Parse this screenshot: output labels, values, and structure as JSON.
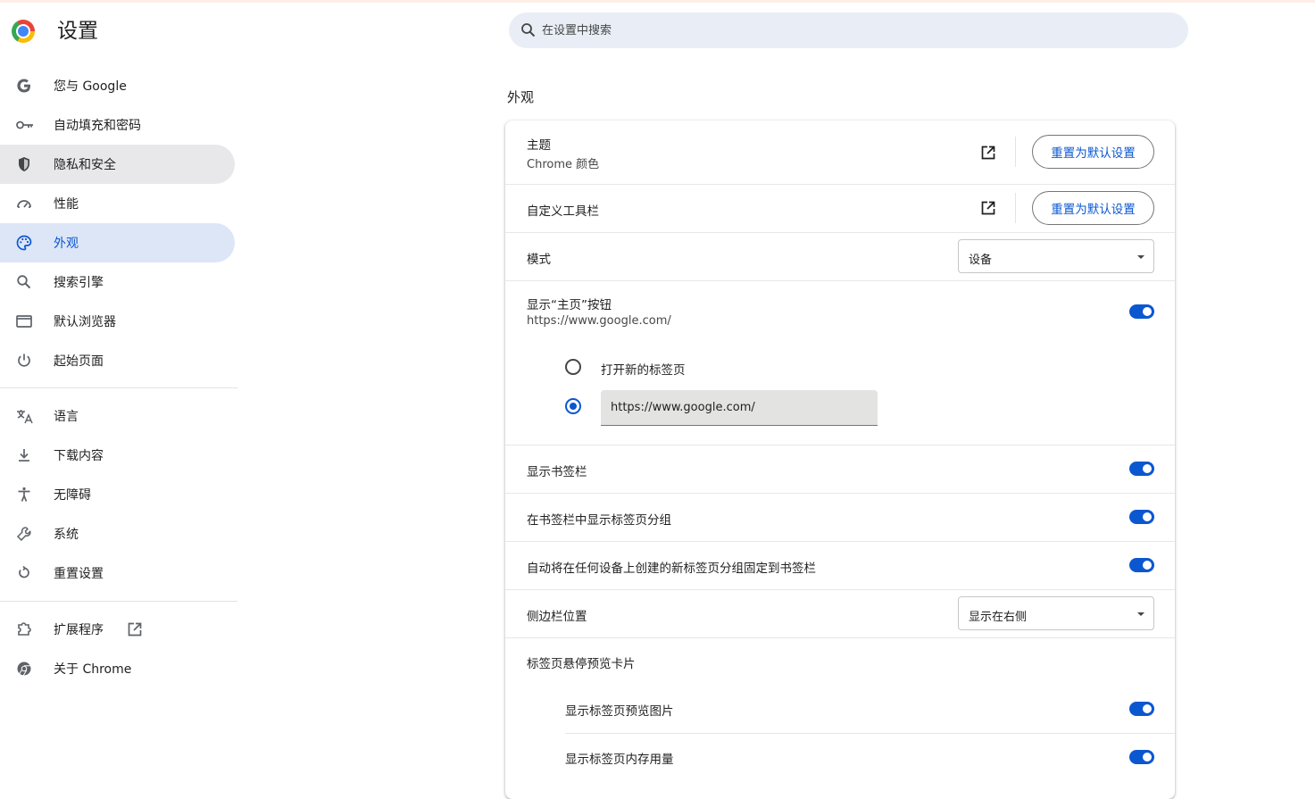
{
  "app": {
    "title": "设置"
  },
  "search": {
    "placeholder": "在设置中搜索"
  },
  "sidebar": {
    "items": [
      {
        "label": "您与 Google",
        "icon": "google-g-icon"
      },
      {
        "label": "自动填充和密码",
        "icon": "key-icon"
      },
      {
        "label": "隐私和安全",
        "icon": "shield-icon"
      },
      {
        "label": "性能",
        "icon": "speedometer-icon"
      },
      {
        "label": "外观",
        "icon": "palette-icon"
      },
      {
        "label": "搜索引擎",
        "icon": "search-icon"
      },
      {
        "label": "默认浏览器",
        "icon": "browser-window-icon"
      },
      {
        "label": "起始页面",
        "icon": "power-icon"
      },
      {
        "label": "语言",
        "icon": "translate-icon"
      },
      {
        "label": "下载内容",
        "icon": "download-icon"
      },
      {
        "label": "无障碍",
        "icon": "accessibility-icon"
      },
      {
        "label": "系统",
        "icon": "wrench-icon"
      },
      {
        "label": "重置设置",
        "icon": "reset-icon"
      },
      {
        "label": "扩展程序",
        "icon": "puzzle-icon"
      },
      {
        "label": "关于 Chrome",
        "icon": "chrome-icon"
      }
    ],
    "active_item": "外观"
  },
  "appearance": {
    "section_title": "外观",
    "theme": {
      "label": "主题",
      "value": "Chrome 颜色",
      "reset_label": "重置为默认设置"
    },
    "toolbar": {
      "label": "自定义工具栏",
      "reset_label": "重置为默认设置"
    },
    "mode": {
      "label": "模式",
      "selected": "设备"
    },
    "home_button": {
      "label": "显示“主页”按钮",
      "value": "https://www.google.com/",
      "enabled": true,
      "option_new_tab": "打开新的标签页",
      "custom_url": "https://www.google.com/"
    },
    "bookmarks_bar": {
      "label": "显示书签栏",
      "enabled": true
    },
    "tab_groups_in_bookmarks": {
      "label": "在书签栏中显示标签页分组",
      "enabled": true
    },
    "auto_pin_tab_groups": {
      "label": "自动将在任何设备上创建的新标签页分组固定到书签栏",
      "enabled": true
    },
    "side_panel": {
      "label": "侧边栏位置",
      "selected": "显示在右侧"
    },
    "hover_card": {
      "label": "标签页悬停预览卡片",
      "preview_images": {
        "label": "显示标签页预览图片",
        "enabled": true
      },
      "memory_usage": {
        "label": "显示标签页内存用量",
        "enabled": true
      }
    }
  },
  "colors": {
    "accent": "#0b57d0",
    "active_nav_bg": "#dde6f7",
    "search_bg": "#e9eef6"
  }
}
